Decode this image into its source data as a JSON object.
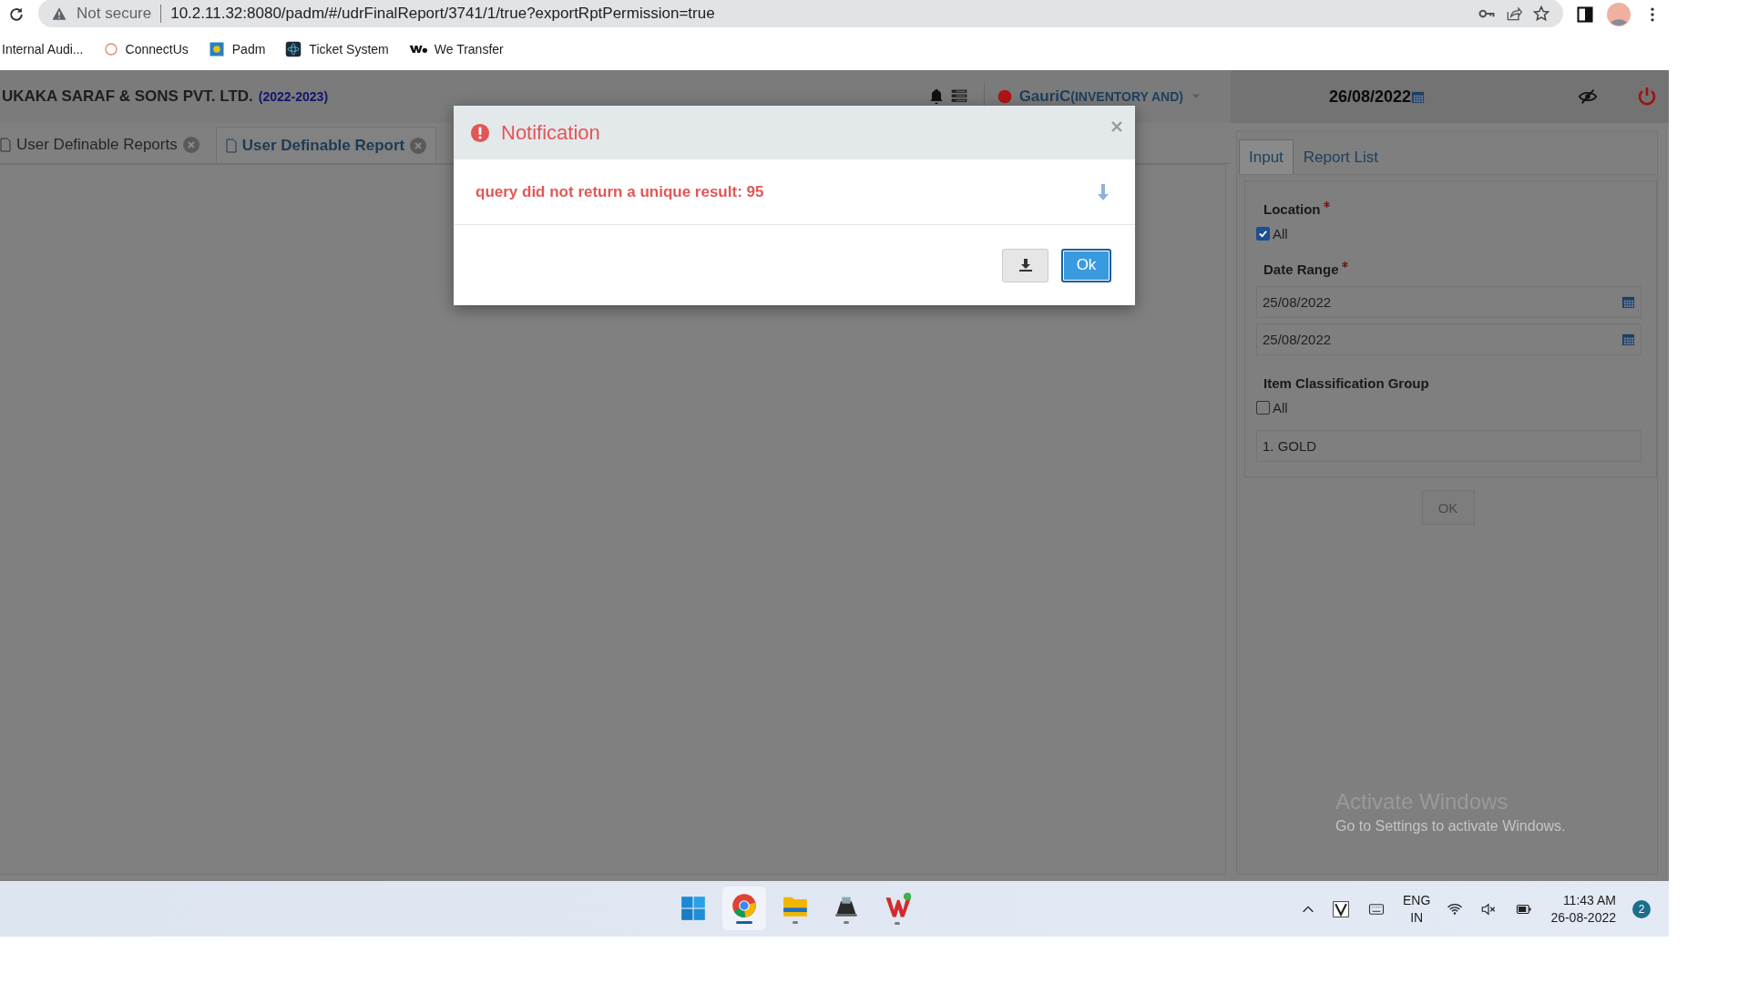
{
  "browser": {
    "security": "Not secure",
    "url": "10.2.11.32:8080/padm/#/udrFinalReport/3741/1/true?exportRptPermission=true",
    "bookmarks": [
      {
        "label": "Internal Audi..."
      },
      {
        "label": "ConnectUs"
      },
      {
        "label": "Padm"
      },
      {
        "label": "Ticket System"
      },
      {
        "label": "We Transfer"
      }
    ]
  },
  "app": {
    "company": "UKAKA SARAF & SONS PVT. LTD.",
    "year": "(2022-2023)",
    "user": "GauriC",
    "role": "(INVENTORY AND)",
    "date": "26/08/2022",
    "tabs": [
      {
        "label": "User Definable Reports",
        "selected": false
      },
      {
        "label": "User Definable Report",
        "selected": true
      }
    ],
    "panel_tabs": [
      {
        "label": "Input",
        "selected": true
      },
      {
        "label": "Report List",
        "selected": false
      }
    ],
    "form": {
      "location": {
        "label": "Location",
        "required": true,
        "all_label": "All",
        "checked": true
      },
      "date_range": {
        "label": "Date Range",
        "required": true,
        "from": "25/08/2022",
        "to": "25/08/2022"
      },
      "item_group": {
        "label": "Item Classification Group",
        "required": false,
        "all_label": "All",
        "checked": false,
        "value": "1. GOLD"
      },
      "ok": "OK"
    }
  },
  "dialog": {
    "title": "Notification",
    "message": "query did not return a unique result: 95",
    "ok": "Ok"
  },
  "activation": {
    "title": "Activate Windows",
    "subtitle": "Go to Settings to activate Windows."
  },
  "taskbar": {
    "apps": [
      {
        "selected": false
      },
      {
        "selected": true
      },
      {
        "selected": false
      },
      {
        "selected": false
      },
      {
        "selected": false
      }
    ],
    "language": "ENG",
    "region": "IN",
    "time": "11:43 AM",
    "date": "26-08-2022",
    "notifications": "2"
  }
}
